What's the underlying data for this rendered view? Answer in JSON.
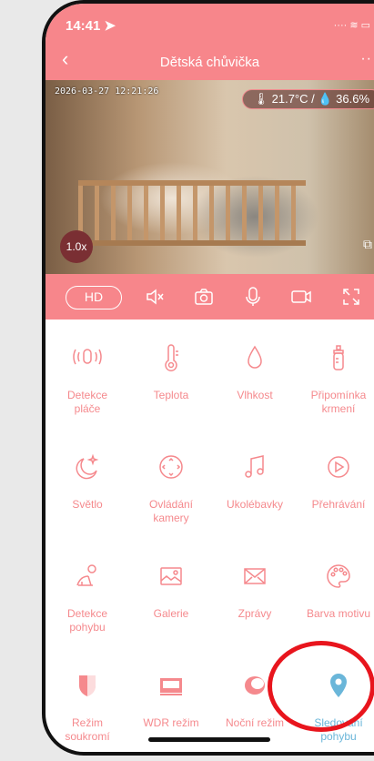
{
  "status": {
    "time": "14:41 ➤",
    "icons": "···· ≋ ▭"
  },
  "nav": {
    "back_glyph": "‹",
    "title": "Dětská chůvička",
    "more_glyph": "··"
  },
  "video": {
    "timestamp": "2026-03-27 12:21:26",
    "sensors": "🌡 21.7°C / 💧 36.6%",
    "zoom": "1.0x"
  },
  "toolbar": {
    "hd_label": "HD"
  },
  "features": [
    {
      "label": "Detekce\npláče",
      "icon": "cry-detection-icon"
    },
    {
      "label": "Teplota",
      "icon": "thermometer-icon"
    },
    {
      "label": "Vlhkost",
      "icon": "droplet-icon"
    },
    {
      "label": "Připomínka\nkrmení",
      "icon": "baby-bottle-icon"
    },
    {
      "label": "Světlo",
      "icon": "moon-star-icon"
    },
    {
      "label": "Ovládání\nkamery",
      "icon": "camera-control-icon"
    },
    {
      "label": "Ukolébavky",
      "icon": "music-note-icon"
    },
    {
      "label": "Přehrávání",
      "icon": "play-circle-icon"
    },
    {
      "label": "Detekce\npohybu",
      "icon": "crawling-baby-icon"
    },
    {
      "label": "Galerie",
      "icon": "gallery-icon"
    },
    {
      "label": "Zprávy",
      "icon": "envelope-icon"
    },
    {
      "label": "Barva motivu",
      "icon": "palette-icon"
    },
    {
      "label": "Režim\nsoukromí",
      "icon": "shield-icon"
    },
    {
      "label": "WDR režim",
      "icon": "wdr-icon"
    },
    {
      "label": "Noční režim",
      "icon": "eye-icon"
    },
    {
      "label": "Sledování\npohybu",
      "icon": "location-pin-icon"
    }
  ],
  "colors": {
    "accent": "#f7868b",
    "highlight": "#6ab6d9",
    "ring": "#e8151d"
  }
}
